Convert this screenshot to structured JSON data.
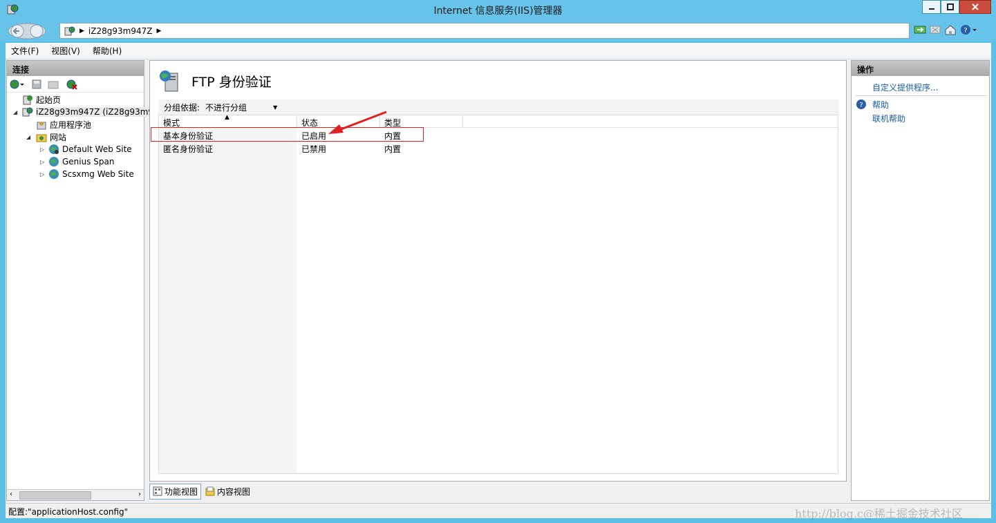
{
  "window": {
    "title": "Internet 信息服务(IIS)管理器"
  },
  "address": {
    "path": "iZ28g93m947Z"
  },
  "menu": {
    "items": [
      "文件(F)",
      "视图(V)",
      "帮助(H)"
    ]
  },
  "connections": {
    "header": "连接",
    "tree": {
      "start_page": "起始页",
      "server": "iZ28g93m947Z (iZ28g93m9",
      "app_pools": "应用程序池",
      "sites": "网站",
      "site_list": [
        "Default Web Site",
        "Genius Span",
        "Scsxmg Web Site"
      ]
    }
  },
  "feature": {
    "title": "FTP 身份验证",
    "group_label": "分组依据:",
    "group_value": "不进行分组",
    "columns": [
      "模式",
      "状态",
      "类型"
    ],
    "rows": [
      {
        "mode": "基本身份验证",
        "status": "已启用",
        "type": "内置"
      },
      {
        "mode": "匿名身份验证",
        "status": "已禁用",
        "type": "内置"
      }
    ]
  },
  "view_tabs": {
    "features": "功能视图",
    "content": "内容视图"
  },
  "actions": {
    "header": "操作",
    "custom_providers": "自定义提供程序...",
    "help": "帮助",
    "online_help": "联机帮助"
  },
  "status": {
    "text": "配置:\"applicationHost.config\""
  },
  "watermark": "http://blog.c@稀土掘金技术社区",
  "colors": {
    "titlebar": "#67c3ea",
    "link": "#1a5ea8",
    "highlight_box": "#e02020"
  }
}
